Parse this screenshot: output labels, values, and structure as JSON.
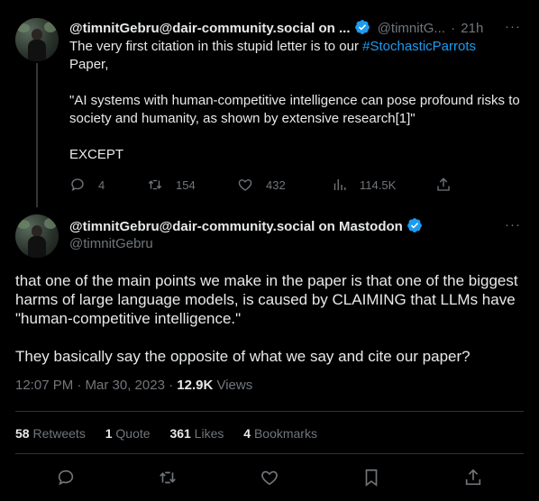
{
  "tweet1": {
    "display_name": "@timnitGebru@dair-community.social on ...",
    "handle": "@timnitG...",
    "separator": "·",
    "time": "21h",
    "text_line1_prefix": "The very first citation in this stupid letter is to our ",
    "hashtag": "#StochasticParrots",
    "text_line1_suffix": "Paper,",
    "quote": "\"AI systems with human-competitive intelligence can pose profound risks to society and humanity, as shown by extensive research[1]\"",
    "closing": "EXCEPT",
    "replies": "4",
    "retweets": "154",
    "likes": "432",
    "views": "114.5K",
    "more": "···"
  },
  "tweet2": {
    "display_name": "@timnitGebru@dair-community.social on Mastodon",
    "handle": "@timnitGebru",
    "more": "···",
    "paragraph1": "that one of the main points we make in the paper is that one of the biggest harms of large language models, is caused by CLAIMING that LLMs have  \"human-competitive intelligence.\"",
    "paragraph2": "They basically say the opposite of what we say and cite our paper?",
    "timestamp": "12:07 PM · Mar 30, 2023 · ",
    "views_count": "12.9K",
    "views_label": " Views",
    "retweets_count": "58",
    "retweets_label": " Retweets",
    "quotes_count": "1",
    "quotes_label": " Quote",
    "likes_count": "361",
    "likes_label": " Likes",
    "bookmarks_count": "4",
    "bookmarks_label": " Bookmarks"
  },
  "colors": {
    "background": "#000000",
    "text": "#e7e9ea",
    "muted": "#71767b",
    "link": "#1d9bf0",
    "verified": "#1d9bf0",
    "divider": "#2f3336"
  },
  "icons": [
    "verified-badge-icon",
    "reply-icon",
    "retweet-icon",
    "like-icon",
    "views-icon",
    "share-icon",
    "bookmark-icon",
    "more-icon"
  ]
}
